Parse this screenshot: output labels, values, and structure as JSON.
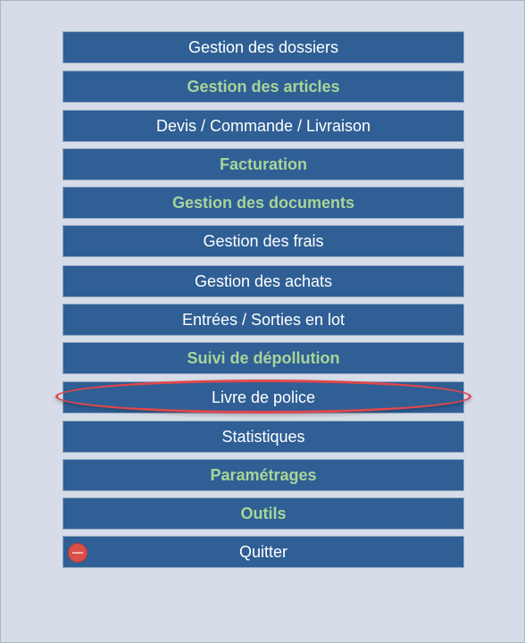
{
  "menu": {
    "items": [
      {
        "label": "Gestion des dossiers",
        "bold": false
      },
      {
        "label": "Gestion des articles",
        "bold": true
      },
      {
        "label": "Devis / Commande / Livraison",
        "bold": false
      },
      {
        "label": "Facturation",
        "bold": true
      },
      {
        "label": "Gestion des documents",
        "bold": true
      },
      {
        "label": "Gestion des frais",
        "bold": false
      },
      {
        "label": "Gestion des achats",
        "bold": false
      },
      {
        "label": "Entrées / Sorties en lot",
        "bold": false
      },
      {
        "label": "Suivi de dépollution",
        "bold": true
      },
      {
        "label": "Livre de police",
        "bold": false
      },
      {
        "label": "Statistiques",
        "bold": false
      },
      {
        "label": "Paramétrages",
        "bold": true
      },
      {
        "label": "Outils",
        "bold": true
      },
      {
        "label": "Quitter",
        "bold": false
      }
    ]
  },
  "colors": {
    "background": "#d6dde8",
    "button": "#2f5f95",
    "text_normal": "#ffffff",
    "text_bold": "#a8d49a",
    "highlight": "#e0474c",
    "quit_icon": "#d9504a"
  },
  "icons": {
    "quit": "stop-icon"
  }
}
